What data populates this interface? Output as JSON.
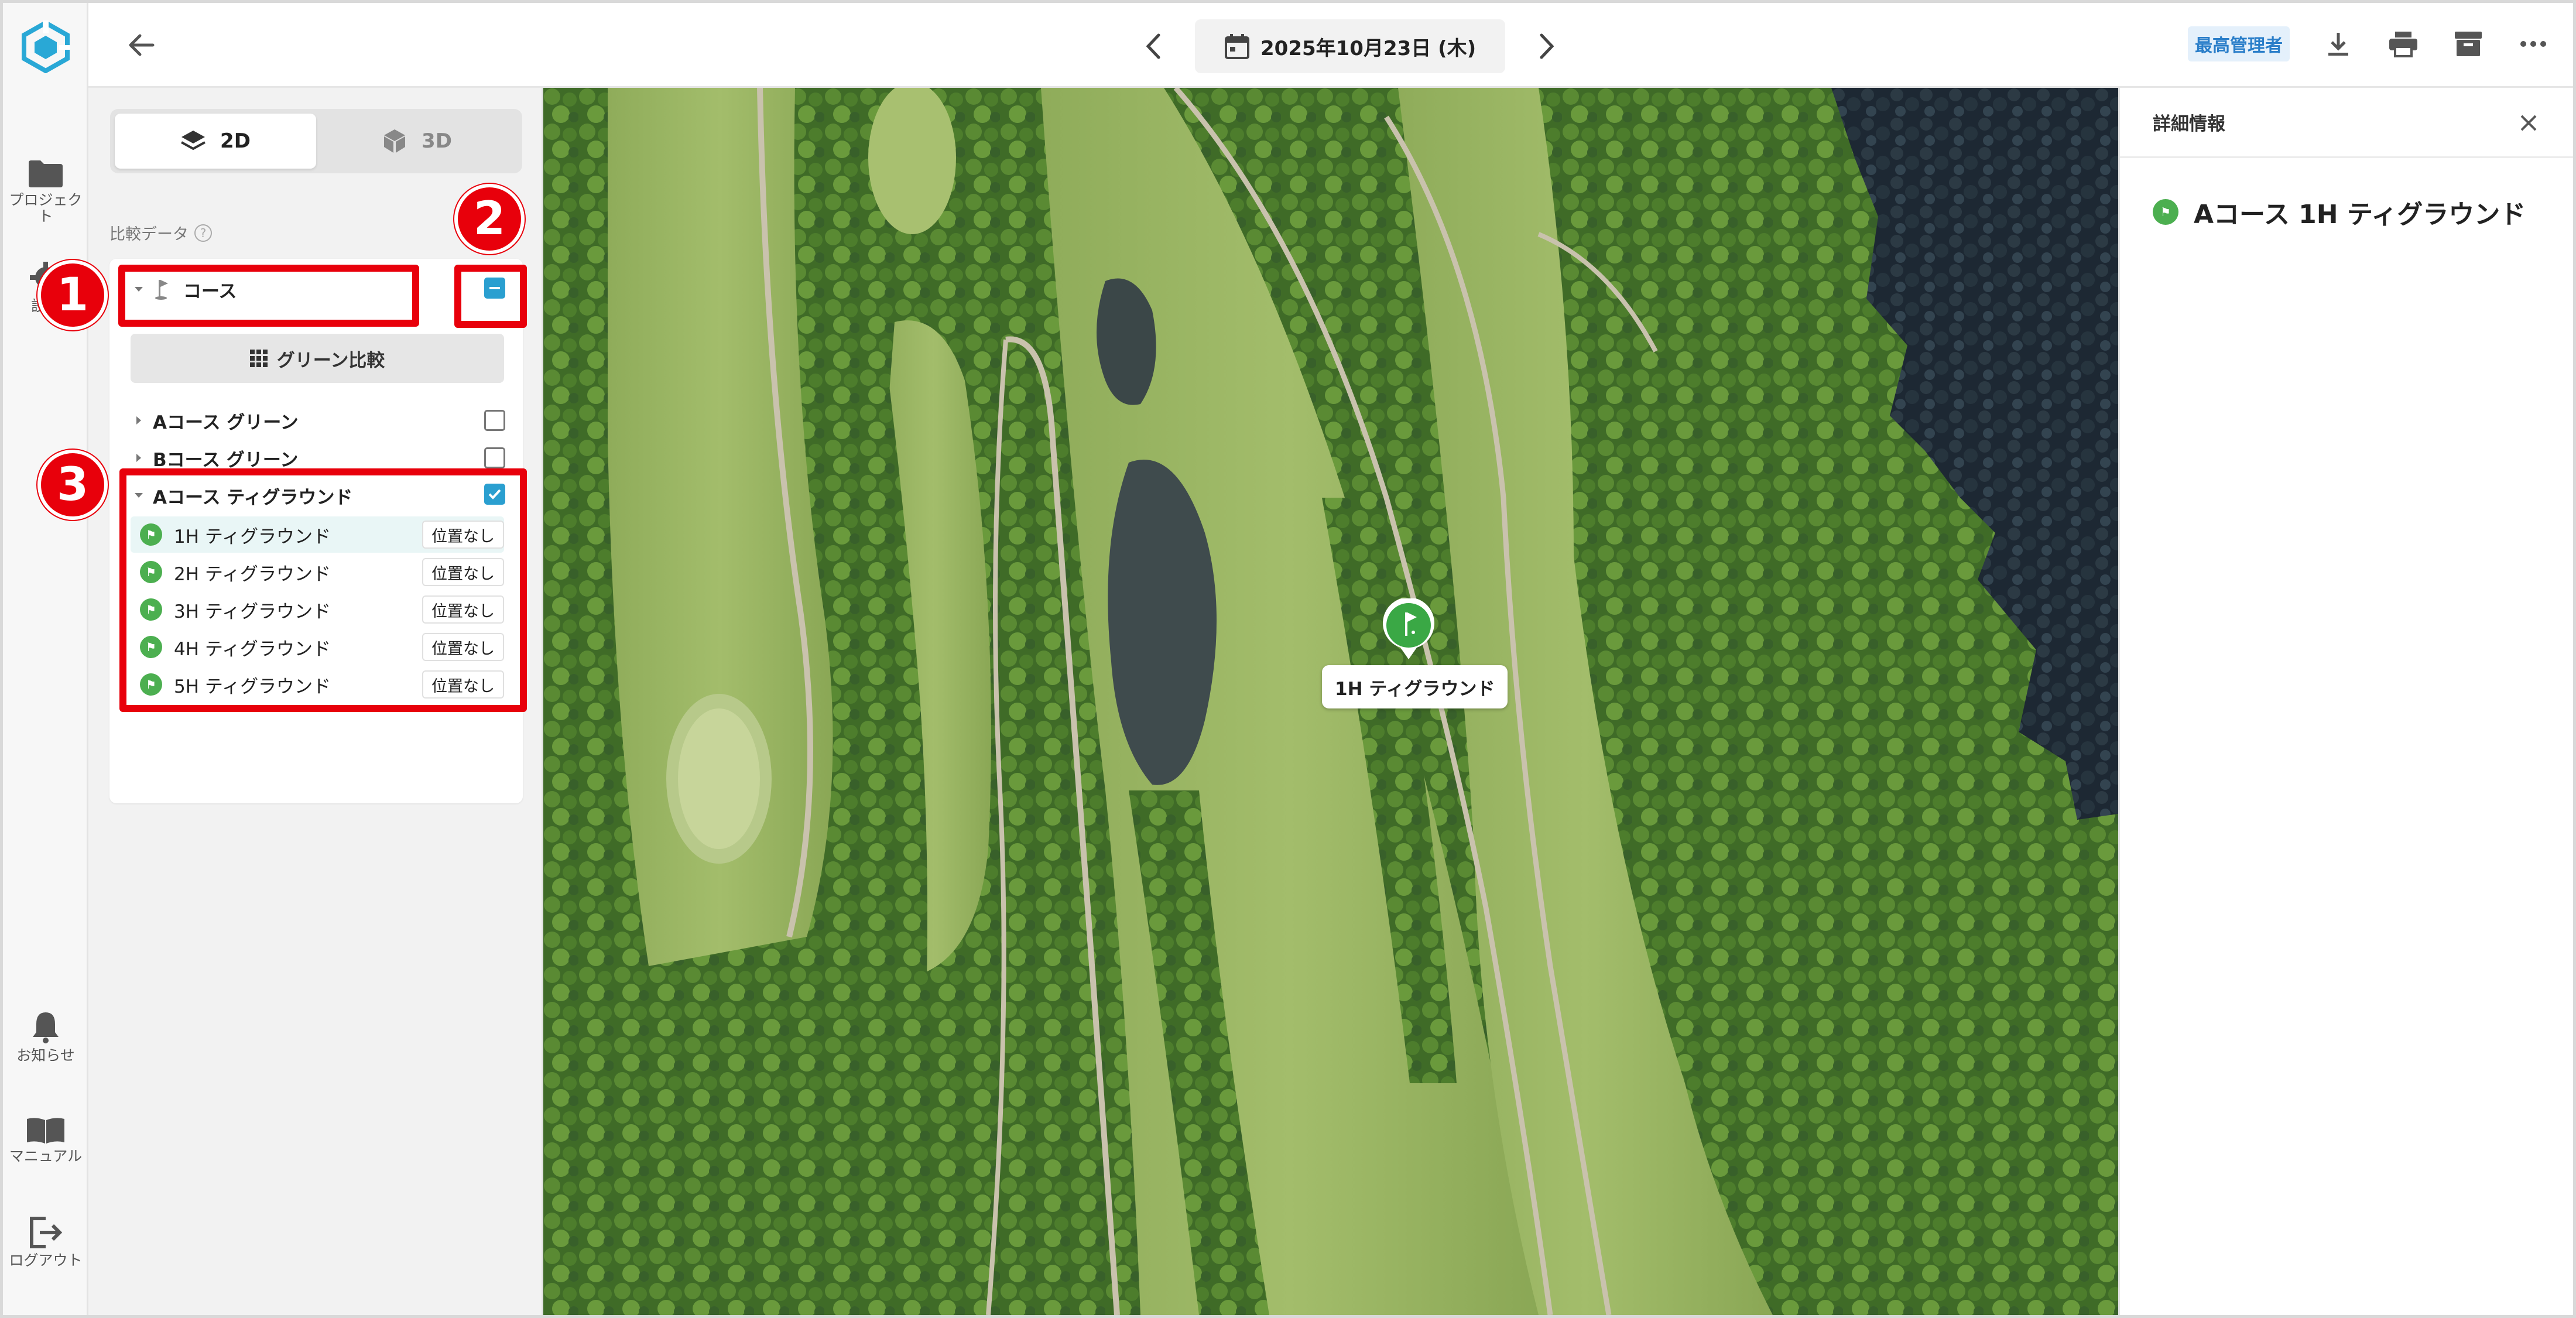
{
  "rail": {
    "project_label": "プロジェクト",
    "settings_label": "設定",
    "notifications_label": "お知らせ",
    "manual_label": "マニュアル",
    "logout_label": "ログアウト"
  },
  "topbar": {
    "date": "2025年10月23日 (木)",
    "role_badge": "最高管理者"
  },
  "panel": {
    "view_tabs": [
      {
        "label": "2D",
        "active": true
      },
      {
        "label": "3D",
        "active": false
      }
    ],
    "section_label": "比較データ",
    "root_group": {
      "label": "コース",
      "checkbox": "indeterminate"
    },
    "green_compare_button": "グリーン比較",
    "groups": [
      {
        "label": "Aコース グリーン",
        "checked": false,
        "expanded": false
      },
      {
        "label": "Bコース グリーン",
        "checked": false,
        "expanded": false
      },
      {
        "label": "Aコース ティグラウンド",
        "checked": true,
        "expanded": true
      }
    ],
    "tee_items": [
      {
        "label": "1H ティグラウンド",
        "badge": "位置なし",
        "selected": true
      },
      {
        "label": "2H ティグラウンド",
        "badge": "位置なし",
        "selected": false
      },
      {
        "label": "3H ティグラウンド",
        "badge": "位置なし",
        "selected": false
      },
      {
        "label": "4H ティグラウンド",
        "badge": "位置なし",
        "selected": false
      },
      {
        "label": "5H ティグラウンド",
        "badge": "位置なし",
        "selected": false
      }
    ]
  },
  "annotations": [
    "1",
    "2",
    "3"
  ],
  "map": {
    "marker_label": "1H ティグラウンド",
    "marker_icon": "flag-pin-icon"
  },
  "detail": {
    "title": "詳細情報",
    "item_label": "Aコース 1H ティグラウンド"
  },
  "colors": {
    "accent": "#2a9fd0",
    "annotation_red": "#e8000b",
    "pin_green": "#4caf50",
    "role_badge_bg": "#e4f0fb"
  }
}
